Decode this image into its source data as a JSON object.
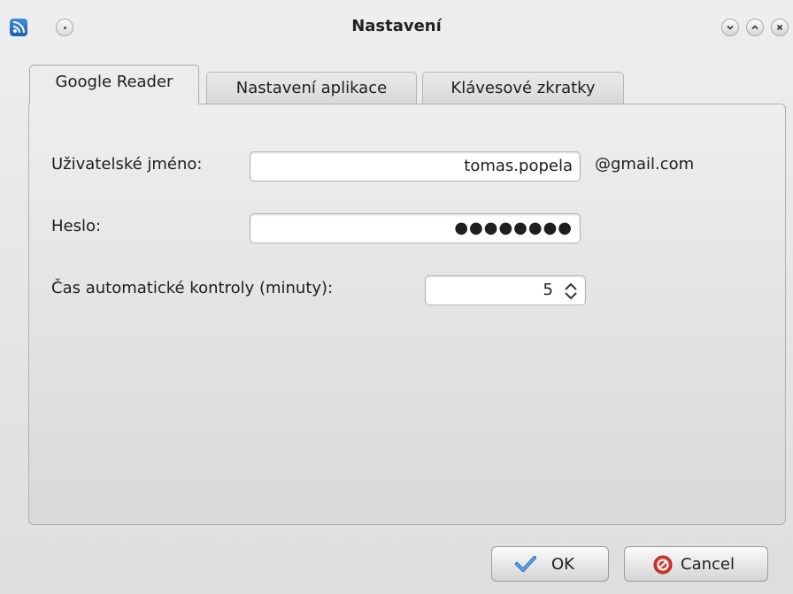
{
  "window": {
    "title": "Nastavení"
  },
  "tabs": [
    {
      "label": "Google Reader",
      "active": true
    },
    {
      "label": "Nastavení aplikace",
      "active": false
    },
    {
      "label": "Klávesové zkratky",
      "active": false
    }
  ],
  "form": {
    "username_label": "Uživatelské jméno:",
    "username_value": "tomas.popela",
    "username_suffix": "@gmail.com",
    "password_label": "Heslo:",
    "password_value": "●●●●●●●●",
    "interval_label": "Čas automatické kontroly (minuty):",
    "interval_value": "5"
  },
  "buttons": {
    "ok_label": "OK",
    "cancel_label": "Cancel"
  },
  "colors": {
    "accent": "#2a6fc9",
    "cancel_red": "#d9362f"
  }
}
